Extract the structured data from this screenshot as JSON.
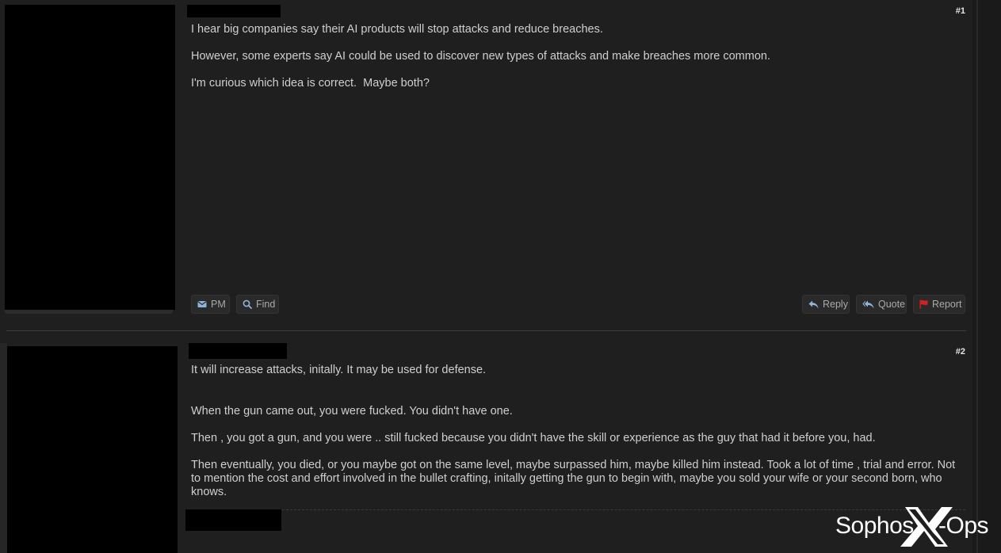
{
  "thread": {
    "posts": [
      {
        "number": "#1",
        "paragraphs": [
          "I hear big companies say their AI products will stop attacks and reduce breaches.",
          "However, some experts say AI could be used to discover new types of attacks and make breaches more common.",
          "I'm curious which idea is correct.  Maybe both?"
        ],
        "buttons": {
          "pm": "PM",
          "find": "Find",
          "reply": "Reply",
          "quote": "Quote",
          "report": "Report"
        }
      },
      {
        "number": "#2",
        "paragraphs": [
          "It will increase attacks, initally. It may be used for defense.",
          "When the gun came out, you were fucked. You didn't have one.",
          "Then , you got a gun, and you were .. still fucked because you didn't have the skill or experience as the guy that had it before you, had.",
          "Then eventually, you died, or you maybe got on the same level, maybe surpassed him, maybe killed him instead. Took a lot of time , trial and error. Not to mention the cost and effort involved in the bullet crafting, initally getting the gun to begin with, maybe you sold your wife or your second born, who knows."
        ]
      }
    ]
  },
  "watermark": {
    "left": "Sophos",
    "right": "-Ops",
    "mark": "X"
  },
  "colors": {
    "background": "#1f1f1f",
    "text": "#cfcfcf",
    "button_bg": "#2a2a2a",
    "button_text": "#a9a9a9",
    "icon_blue": "#8fb3d9",
    "report_red": "#d42020",
    "redaction": "#000000",
    "watermark": "#ffffff"
  },
  "icons": {
    "pm": "envelope-icon",
    "find": "magnifier-icon",
    "reply": "reply-arrow-icon",
    "quote": "reply-all-icon",
    "report": "flag-icon"
  }
}
